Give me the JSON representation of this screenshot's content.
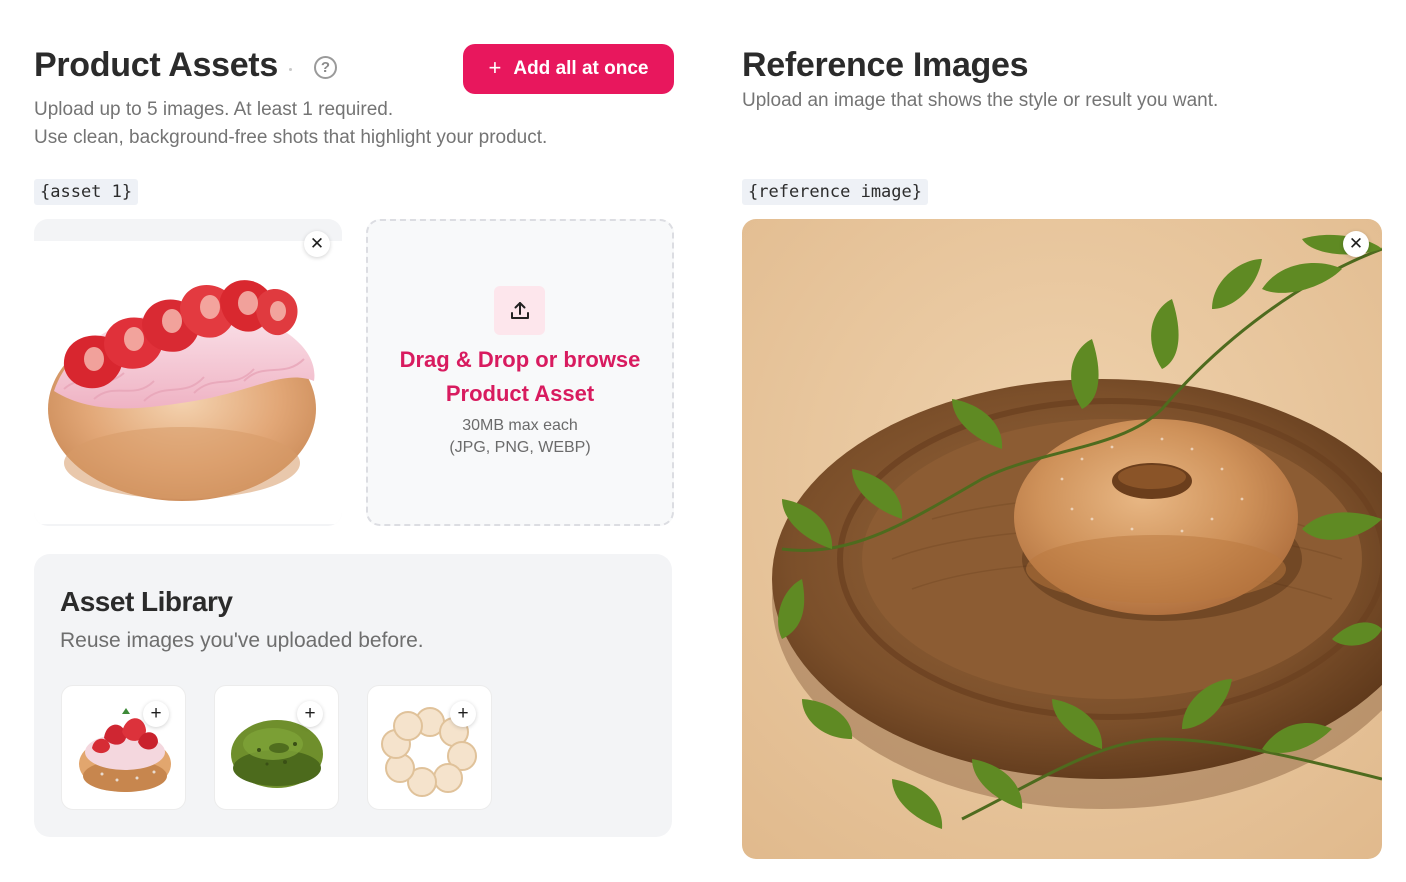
{
  "product_assets": {
    "title": "Product Assets",
    "help_icon": "question-circle-icon",
    "add_all_label": "Add all at once",
    "subtitle_line1": "Upload up to 5 images. At least 1 required.",
    "subtitle_line2": "Use clean, background-free shots that highlight your product.",
    "asset_tag": "{asset 1}",
    "asset_image": "strawberry-cream-donut",
    "dropzone": {
      "title_line1": "Drag & Drop or browse",
      "title_line2": "Product Asset",
      "size_limit": "30MB max each",
      "formats": "(JPG, PNG, WEBP)"
    }
  },
  "asset_library": {
    "title": "Asset Library",
    "subtitle": "Reuse images you've uploaded before.",
    "items": [
      {
        "image": "strawberry-donut-thumb"
      },
      {
        "image": "matcha-donut-thumb"
      },
      {
        "image": "pon-de-ring-donut-thumb"
      }
    ]
  },
  "reference_images": {
    "title": "Reference Images",
    "subtitle": "Upload an image that shows the style or result you want.",
    "tag": "{reference image}",
    "image": "sugar-donut-on-wooden-board"
  },
  "colors": {
    "accent": "#e8175d",
    "accent_text": "#d81b5f",
    "panel_bg": "#f3f4f6"
  }
}
